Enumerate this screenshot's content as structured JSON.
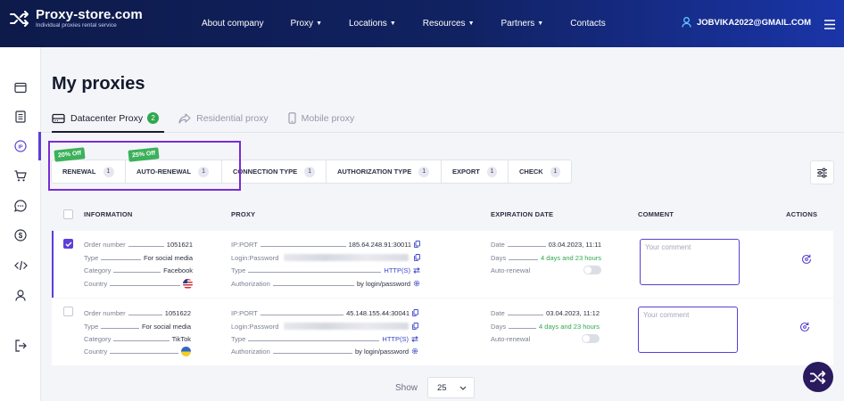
{
  "header": {
    "brand": "Proxy-store.com",
    "tagline": "Individual proxies rental service",
    "nav": [
      {
        "label": "About company",
        "dropdown": false
      },
      {
        "label": "Proxy",
        "dropdown": true
      },
      {
        "label": "Locations",
        "dropdown": true
      },
      {
        "label": "Resources",
        "dropdown": true
      },
      {
        "label": "Partners",
        "dropdown": true
      },
      {
        "label": "Contacts",
        "dropdown": false
      }
    ],
    "user_email": "JOBVIKA2022@GMAIL.COM"
  },
  "sidebar": {
    "items": [
      "wallet-icon",
      "document-icon",
      "ip-icon",
      "cart-icon",
      "chat-icon",
      "dollar-icon",
      "code-icon",
      "user-icon",
      "logout-icon"
    ],
    "active": "ip-icon"
  },
  "page": {
    "title": "My proxies",
    "tabs": [
      {
        "label": "Datacenter Proxy",
        "badge": "2",
        "active": true
      },
      {
        "label": "Residential proxy",
        "active": false
      },
      {
        "label": "Mobile proxy",
        "active": false
      }
    ]
  },
  "toolbar": {
    "buttons": [
      {
        "label": "RENEWAL",
        "count": "1",
        "promo": "20% Off"
      },
      {
        "label": "AUTO-RENEWAL",
        "count": "1",
        "promo": "25% Off"
      },
      {
        "label": "CONNECTION TYPE",
        "count": "1"
      },
      {
        "label": "AUTHORIZATION TYPE",
        "count": "1"
      },
      {
        "label": "EXPORT",
        "count": "1"
      },
      {
        "label": "CHECK",
        "count": "1"
      }
    ]
  },
  "table": {
    "headers": [
      "INFORMATION",
      "PROXY",
      "EXPIRATION DATE",
      "COMMENT",
      "ACTIONS"
    ],
    "rows": [
      {
        "selected": true,
        "info": {
          "order_label": "Order number",
          "order": "1051621",
          "type_label": "Type",
          "type": "For social media",
          "category_label": "Category",
          "category": "Facebook",
          "country_label": "Country",
          "country_flag": "us"
        },
        "proxy": {
          "ip_label": "IP:PORT",
          "ip": "185.64.248.91:30011",
          "login_label": "Login:Password",
          "type_label": "Type",
          "type": "HTTP(S)",
          "auth_label": "Authorization",
          "auth": "by login/password"
        },
        "expiration": {
          "date_label": "Date",
          "date": "03.04.2023, 11:11",
          "days_label": "Days",
          "days": "4 days and 23 hours",
          "auto_label": "Auto-renewal"
        },
        "comment_placeholder": "Your comment"
      },
      {
        "selected": false,
        "info": {
          "order_label": "Order number",
          "order": "1051622",
          "type_label": "Type",
          "type": "For social media",
          "category_label": "Category",
          "category": "TikTok",
          "country_label": "Country",
          "country_flag": "ua"
        },
        "proxy": {
          "ip_label": "IP:PORT",
          "ip": "45.148.155.44:30041",
          "login_label": "Login:Password",
          "type_label": "Type",
          "type": "HTTP(S)",
          "auth_label": "Authorization",
          "auth": "by login/password"
        },
        "expiration": {
          "date_label": "Date",
          "date": "03.04.2023, 11:12",
          "days_label": "Days",
          "days": "4 days and 23 hours",
          "auto_label": "Auto-renewal"
        },
        "comment_placeholder": "Your comment"
      }
    ]
  },
  "footer": {
    "show_label": "Show",
    "page_size": "25"
  },
  "colors": {
    "accent": "#5b3fd6",
    "highlight": "#7a2bd6",
    "green": "#2fa84f",
    "header_dark": "#0d1a4a"
  }
}
